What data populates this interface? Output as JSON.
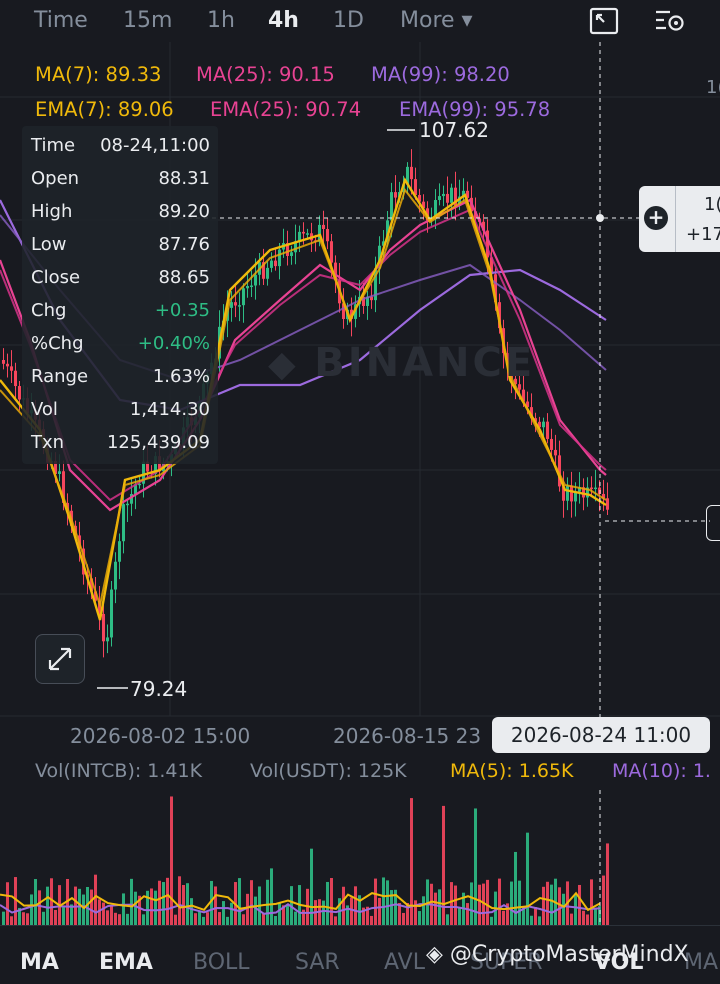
{
  "timeframes": [
    {
      "label": "Time",
      "active": false
    },
    {
      "label": "15m",
      "active": false
    },
    {
      "label": "1h",
      "active": false
    },
    {
      "label": "4h",
      "active": true
    },
    {
      "label": "1D",
      "active": false
    },
    {
      "label": "More ▾",
      "active": false
    }
  ],
  "toolbar_icons": [
    "fullscreen-chart-icon",
    "indicator-settings-icon"
  ],
  "legend": {
    "ma7": "MA(7): 89.33",
    "ma25": "MA(25): 90.15",
    "ma99": "MA(99): 98.20",
    "ema7": "EMA(7): 89.06",
    "ema25": "EMA(25): 90.74",
    "ema99": "EMA(99): 95.78"
  },
  "info_panel": {
    "rows": [
      {
        "k": "Time",
        "v": "08-24,11:00"
      },
      {
        "k": "Open",
        "v": "88.31"
      },
      {
        "k": "High",
        "v": "89.20"
      },
      {
        "k": "Low",
        "v": "87.76"
      },
      {
        "k": "Close",
        "v": "88.65"
      },
      {
        "k": "Chg",
        "v": "+0.35"
      },
      {
        "k": "%Chg",
        "v": "+0.40%"
      },
      {
        "k": "Range",
        "v": "1.63%"
      },
      {
        "k": "Vol",
        "v": "1,414.30"
      },
      {
        "k": "Txn",
        "v": "125,439.09"
      }
    ]
  },
  "price_marks": {
    "high": "107.62",
    "low": "79.24"
  },
  "watermark": "BINANCE",
  "right_edge": {
    "top": "1(",
    "bubble_line1": "1(",
    "bubble_line2": "+17"
  },
  "x_axis": {
    "d1": "2026-08-02 15:00",
    "d2": "2026-08-15 23",
    "crosshair": "2026-08-24 11:00"
  },
  "volume_legend": {
    "a": "Vol(INTCB): 1.41K",
    "b": "Vol(USDT): 125K",
    "c": "MA(5): 1.65K",
    "d": "MA(10): 1."
  },
  "bottom_tabs": [
    {
      "label": "MA",
      "active": true
    },
    {
      "label": "EMA",
      "active": true
    },
    {
      "label": "BOLL",
      "active": false
    },
    {
      "label": "SAR",
      "active": false
    },
    {
      "label": "AVL",
      "active": false
    },
    {
      "label": "SUPER",
      "active": false
    },
    {
      "label": "VOL",
      "active": true
    },
    {
      "label": "MA",
      "active": false
    }
  ],
  "credit": "@CryptoMasterMindX",
  "colors": {
    "up": "#2ebd85",
    "down": "#f6465d",
    "ma7": "#f0b90b",
    "ma25": "#e84393",
    "ma99": "#9c6ade",
    "bg": "#181a20"
  }
}
